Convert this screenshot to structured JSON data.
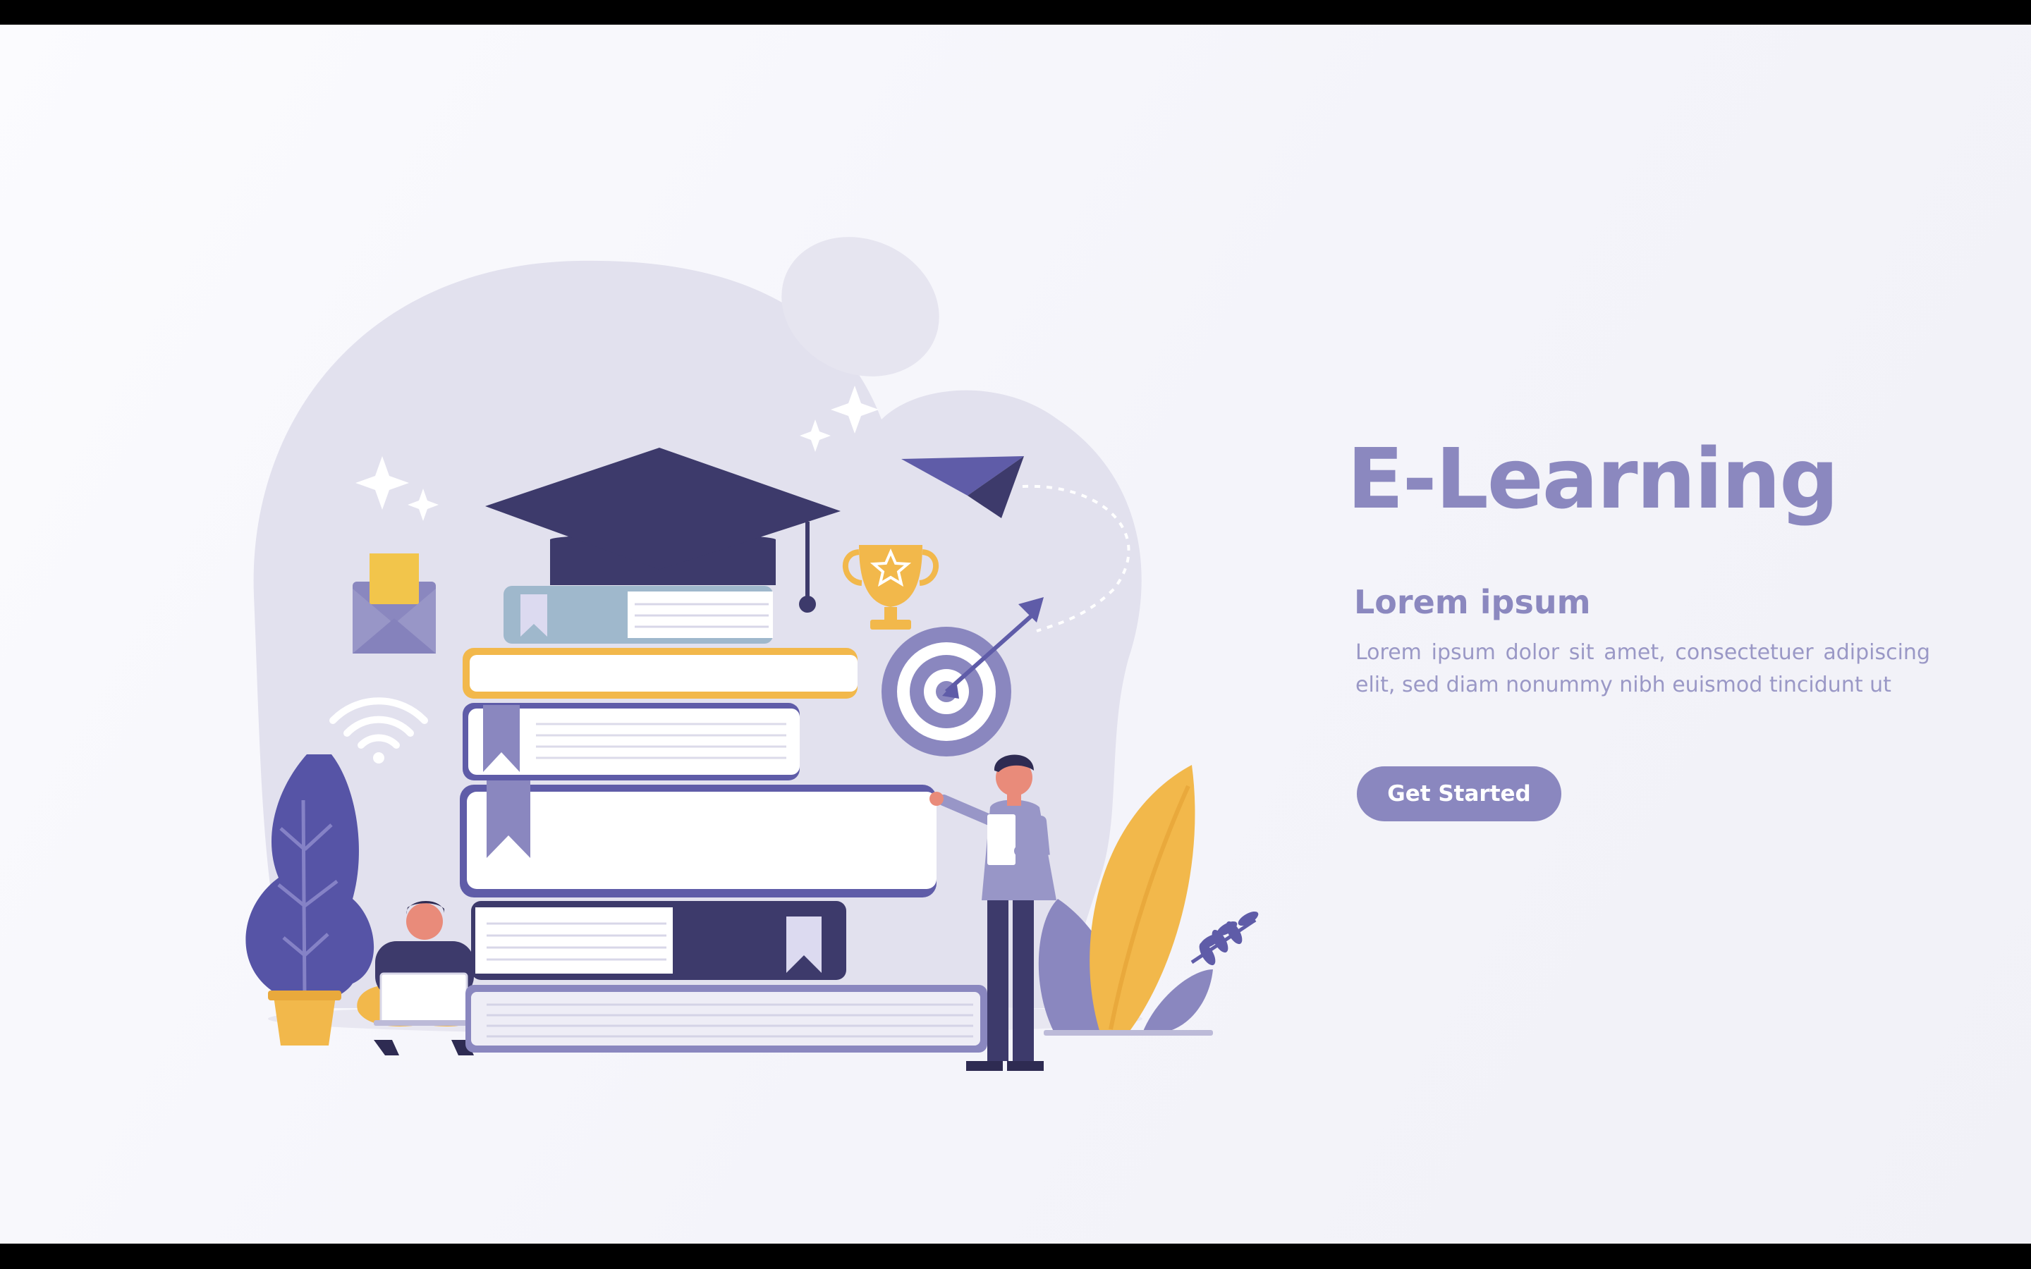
{
  "hero": {
    "title": "E-Learning",
    "subtitle": "Lorem ipsum",
    "body": "Lorem ipsum dolor sit amet, consectetuer adipiscing elit, sed diam nonummy nibh euismod tincidunt ut",
    "cta_label": "Get Started"
  },
  "illustration": {
    "icons": [
      "graduation-cap-icon",
      "envelope-icon",
      "wifi-icon",
      "trophy-icon",
      "target-icon",
      "paper-plane-icon",
      "sparkle-icon",
      "bookmark-icon",
      "plant-icon",
      "leaf-icon"
    ]
  },
  "colors": {
    "accent": "#8a87bf",
    "navy": "#3d3a6b",
    "indigo": "#5f5ca8",
    "gold": "#f2b84b",
    "background": "#f4f4fa"
  }
}
